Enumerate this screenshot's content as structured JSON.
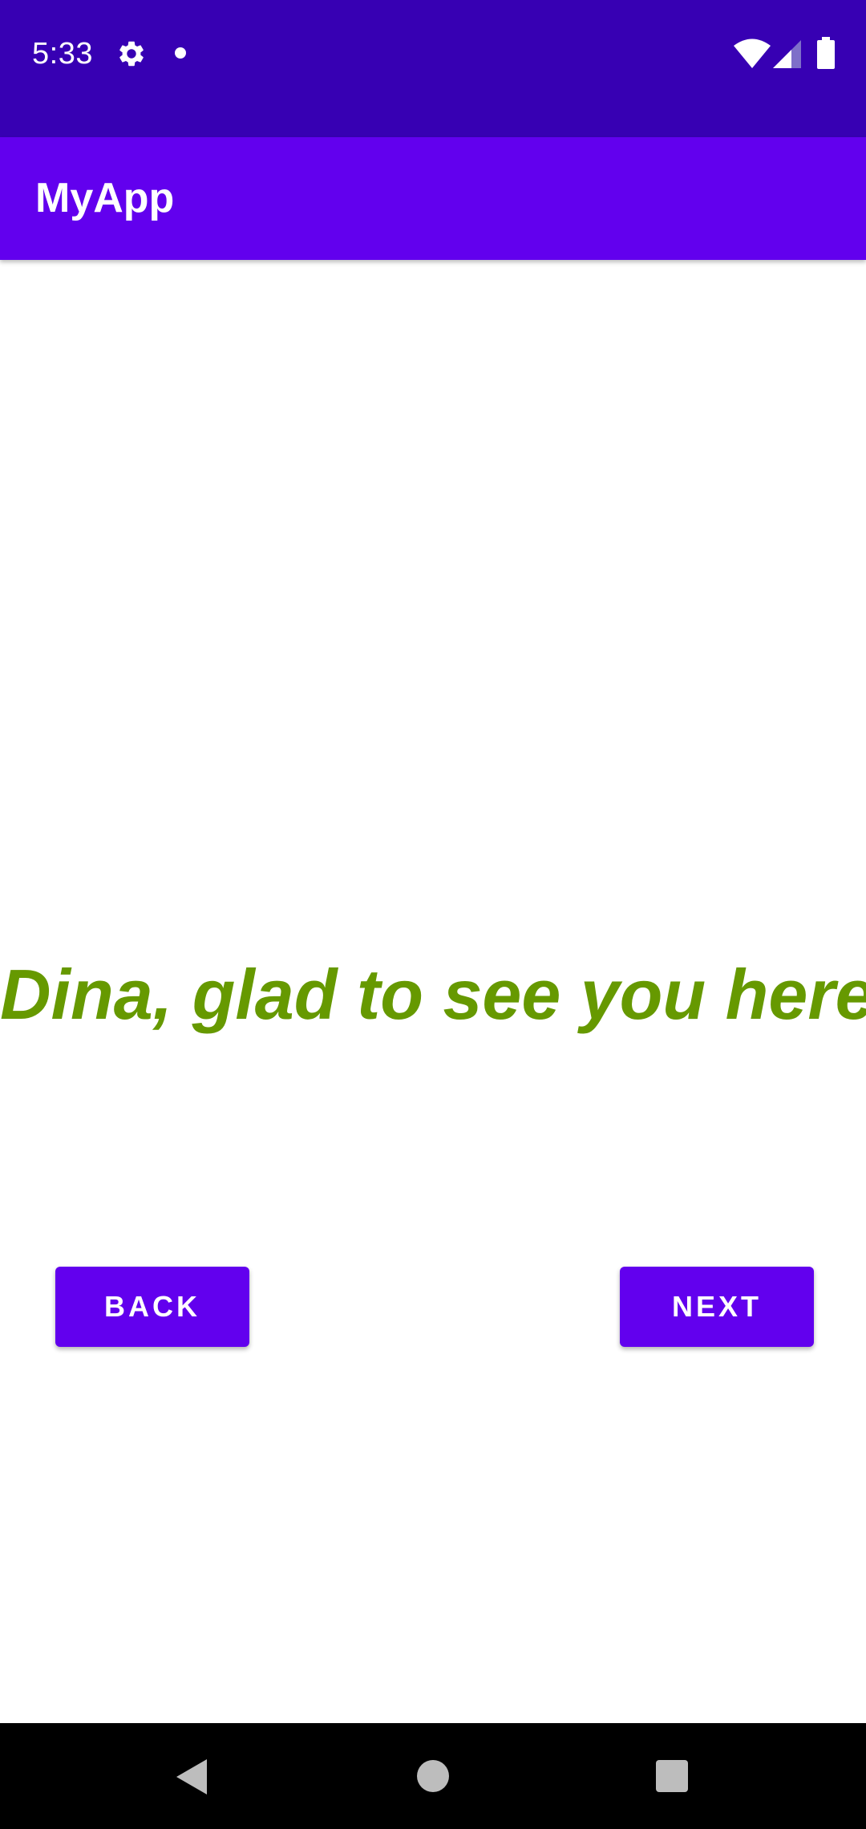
{
  "status_bar": {
    "time": "5:33",
    "icons": [
      "gear-icon",
      "notification-dot-icon",
      "wifi-icon",
      "cell-signal-icon",
      "battery-icon"
    ]
  },
  "app_bar": {
    "title": "MyApp"
  },
  "main": {
    "greeting": "Dina, glad to see you here!"
  },
  "buttons": {
    "back_label": "BACK",
    "next_label": "NEXT"
  },
  "nav_bar": {
    "icons": [
      "nav-back-icon",
      "nav-home-icon",
      "nav-recents-icon"
    ]
  },
  "colors": {
    "status_bar": "#3700B3",
    "primary": "#6200EE",
    "greeting_text": "#669900",
    "background": "#FFFFFF"
  }
}
